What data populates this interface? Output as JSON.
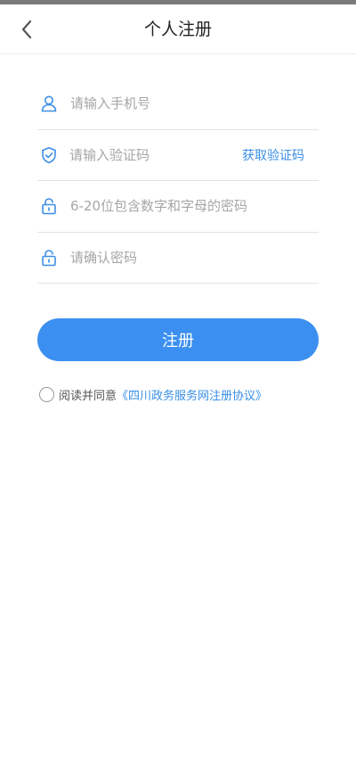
{
  "header": {
    "title": "个人注册",
    "back_icon": "chevron-left-icon"
  },
  "form": {
    "phone": {
      "placeholder": "请输入手机号",
      "value": "",
      "icon": "user-icon"
    },
    "code": {
      "placeholder": "请输入验证码",
      "value": "",
      "icon": "shield-check-icon",
      "action_label": "获取验证码"
    },
    "password": {
      "placeholder": "6-20位包含数字和字母的密码",
      "value": "",
      "icon": "lock-icon"
    },
    "confirm": {
      "placeholder": "请确认密码",
      "value": "",
      "icon": "lock-icon"
    }
  },
  "register_label": "注册",
  "agreement": {
    "checked": false,
    "prefix": "阅读并同意",
    "link_label": "《四川政务服务网注册协议》"
  },
  "colors": {
    "accent": "#3b8ff0",
    "link": "#3a8ee6",
    "placeholder": "#a6a6a6",
    "divider": "#e3e3e3"
  }
}
